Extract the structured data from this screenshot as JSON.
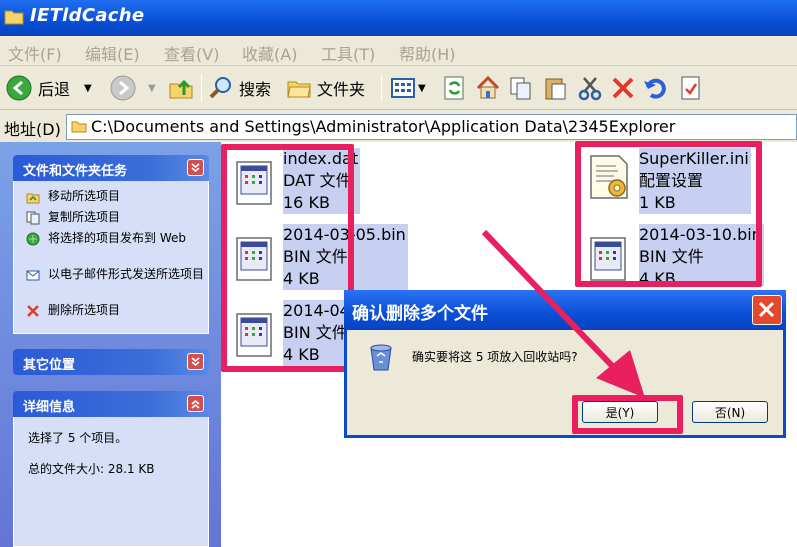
{
  "window": {
    "title": "IETldCache"
  },
  "menu": [
    "文件(F)",
    "编辑(E)",
    "查看(V)",
    "收藏(A)",
    "工具(T)",
    "帮助(H)"
  ],
  "toolbar": {
    "back_label": "后退",
    "search_label": "搜索",
    "folders_label": "文件夹"
  },
  "address": {
    "label": "地址(D)",
    "path": "C:\\Documents and Settings\\Administrator\\Application Data\\2345Explorer"
  },
  "sidebar": {
    "tasks": {
      "title": "文件和文件夹任务",
      "items": [
        {
          "label": "移动所选项目",
          "icon": "move-icon"
        },
        {
          "label": "复制所选项目",
          "icon": "copy-icon"
        },
        {
          "label": "将选择的项目发布到 Web",
          "icon": "publish-web-icon"
        },
        {
          "label": "以电子邮件形式发送所选项目",
          "icon": "email-icon"
        },
        {
          "label": "删除所选项目",
          "icon": "delete-icon"
        }
      ]
    },
    "other": {
      "title": "其它位置"
    },
    "details": {
      "title": "详细信息",
      "selected": "选择了 5 个项目。",
      "total_size": "总的文件大小: 28.1 KB"
    }
  },
  "files": [
    {
      "name": "index.dat",
      "type": "DAT 文件",
      "size": "16 KB"
    },
    {
      "name": "2014-03-05.bin",
      "type": "BIN 文件",
      "size": "4 KB"
    },
    {
      "name": "2014-04",
      "type": "BIN 文件",
      "size": "4 KB"
    },
    {
      "name": "SuperKiller.ini",
      "type": "配置设置",
      "size": "1 KB"
    },
    {
      "name": "2014-03-10.bin",
      "type": "BIN 文件",
      "size": "4 KB"
    }
  ],
  "dialog": {
    "title": "确认删除多个文件",
    "message": "确实要将这 5 项放入回收站吗?",
    "yes_label": "是(Y)",
    "no_label": "否(N)"
  },
  "colors": {
    "highlight": "#e8205f",
    "xp_blue": "#0a4fd6"
  }
}
